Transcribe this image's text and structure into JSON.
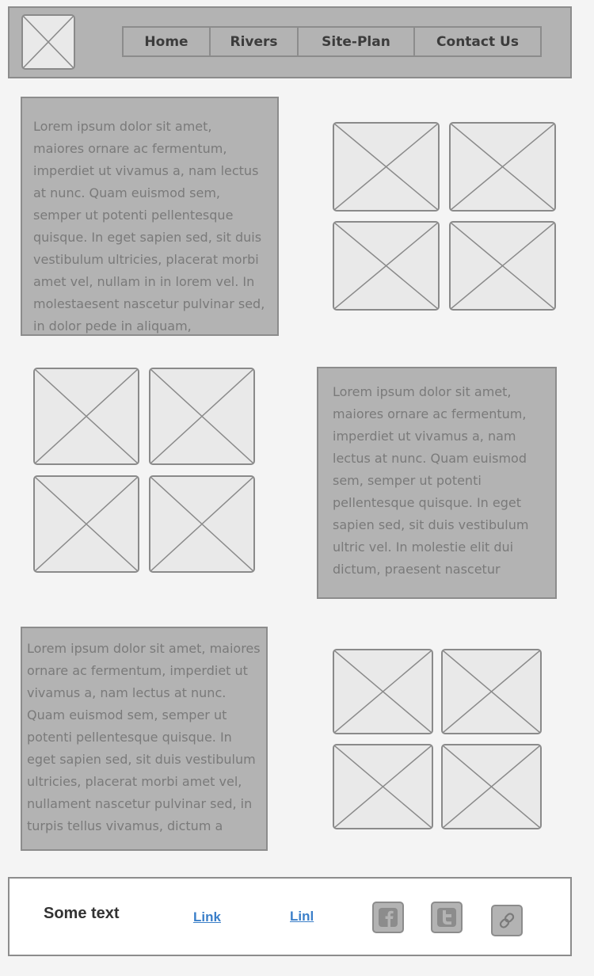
{
  "header": {
    "logo_icon": "image-placeholder-icon",
    "nav": [
      {
        "label": "Home"
      },
      {
        "label": "Rivers"
      },
      {
        "label": "Site-Plan"
      },
      {
        "label": "Contact Us"
      }
    ]
  },
  "sections": [
    {
      "text": "Lorem ipsum dolor sit amet, maiores ornare ac fermentum, imperdiet ut vivamus a, nam lectus at nunc. Quam euismod sem, semper ut potenti pellentesque quisque. In eget sapien sed, sit duis vestibulum ultricies, placerat morbi amet vel, nullam in in lorem vel. In molestaesent nascetur pulvinar sed, in dolor pede in aliquam,"
    },
    {
      "text": "Lorem ipsum dolor sit amet, maiores ornare ac fermentum, imperdiet ut vivamus a, nam lectus at nunc. Quam euismod sem, semper ut potenti pellentesque quisque. In eget sapien sed, sit duis vestibulum ultric vel. In molestie elit dui dictum, praesent nascetur"
    },
    {
      "text": "Lorem ipsum dolor sit amet, maiores ornare ac fermentum, imperdiet ut vivamus a, nam lectus at nunc. Quam euismod sem, semper ut potenti pellentesque quisque. In eget sapien sed, sit duis vestibulum ultricies, placerat morbi amet vel, nullament nascetur pulvinar sed, in turpis tellus vivamus, dictum a"
    }
  ],
  "footer": {
    "text": "Some text",
    "link1": "Link",
    "link2": "Linl",
    "icons": [
      "facebook-icon",
      "twitter-icon",
      "link-icon"
    ]
  },
  "colors": {
    "panel": "#b3b3b3",
    "border": "#8c8c8c",
    "placeholder": "#e9e9e9",
    "link": "#3b7fc9"
  }
}
